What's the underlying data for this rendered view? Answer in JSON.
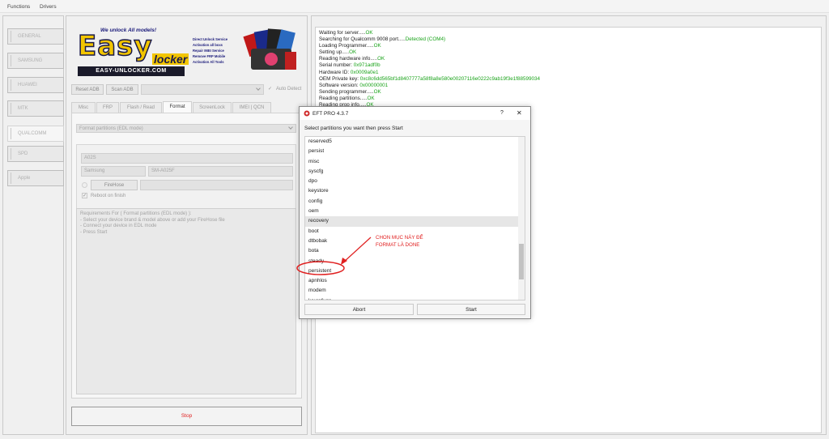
{
  "menu": {
    "functions": "Functions",
    "drivers": "Drivers"
  },
  "sidebar": {
    "items": [
      "GENERAL",
      "SAMSUNG",
      "HUAWEI",
      "MTK",
      "QUALCOMM",
      "SPD",
      "Apple"
    ],
    "active": "QUALCOMM"
  },
  "logo": {
    "tagline": "We unlock All models!",
    "brand_easy": "Easy",
    "brand_locker": "locker",
    "site": "EASY-UNLOCKER.COM",
    "features": [
      "Direct Unlock Service",
      "Activation all boxs",
      "Repair IMEI Service",
      "Remove FRP Mobile",
      "Activation All Tools"
    ]
  },
  "top_controls": {
    "reset_adb": "Reset ADB",
    "scan_adb": "Scan ADB",
    "auto_detect": "Auto Detect"
  },
  "tabs": [
    "Misc",
    "FRP",
    "Flash / Read",
    "Format",
    "ScreenLock",
    "IMEI | QCN"
  ],
  "active_tab": "Format",
  "format": {
    "operation": "Format partitions (EDL mode)",
    "model_field": "A02S",
    "brand": "Samsung",
    "model": "SM-A025F",
    "firehose": "FireHose",
    "reboot_on_finish": "Reboot on finish",
    "requirements": [
      "Requirements For ( Format partitions (EDL mode) ):",
      "- Select your device brand & model above or add your FireHose file",
      "- Connect your device in EDL mode",
      "- Press Start"
    ]
  },
  "stop_label": "Stop",
  "log": [
    {
      "label": "Waiting for server.....",
      "value": "OK"
    },
    {
      "label": "Searching for Qualcomm 9008 port.....",
      "value": "Detected (COM4)"
    },
    {
      "label": "Loading Programmer.....",
      "value": "OK"
    },
    {
      "label": "Setting up.....",
      "value": "OK"
    },
    {
      "label": "Reading hardware info.....",
      "value": "OK"
    },
    {
      "label": "Serial number: ",
      "value": "0x971adf0b"
    },
    {
      "label": "Hardware ID: ",
      "value": "0x0009a0e1"
    },
    {
      "label": "OEM Private key: ",
      "value": "0xc8c6dd565bf1d8407777a58f8a8e580e00207116e0222c9ab19f3e1f88599034"
    },
    {
      "label": "Software version: ",
      "value": "0x00000001"
    },
    {
      "label": "Sending programmer.....",
      "value": "OK"
    },
    {
      "label": "Reading partitions.....",
      "value": "OK"
    },
    {
      "label": "Reading prop info.....",
      "value": "OK"
    }
  ],
  "dialog": {
    "title": "EFT PRO 4.3.7",
    "help": "?",
    "close": "✕",
    "prompt": "Select partitions you want then press Start",
    "partitions": [
      "reserved5",
      "persist",
      "misc",
      "syscfg",
      "dpo",
      "keystore",
      "config",
      "oem",
      "recovery",
      "boot",
      "dtbobak",
      "bota",
      "steady",
      "persistent",
      "apnhlos",
      "modem",
      "keyrefuge"
    ],
    "selected": "recovery",
    "abort_label": "Abort",
    "start_label": "Start"
  },
  "annotation": {
    "line1": "CHON MỤC NÀY ĐỂ",
    "line2": "FORMAT LÀ DONE"
  },
  "colors": {
    "ok_green": "#1aa31a",
    "annotation_red": "#e02020"
  }
}
